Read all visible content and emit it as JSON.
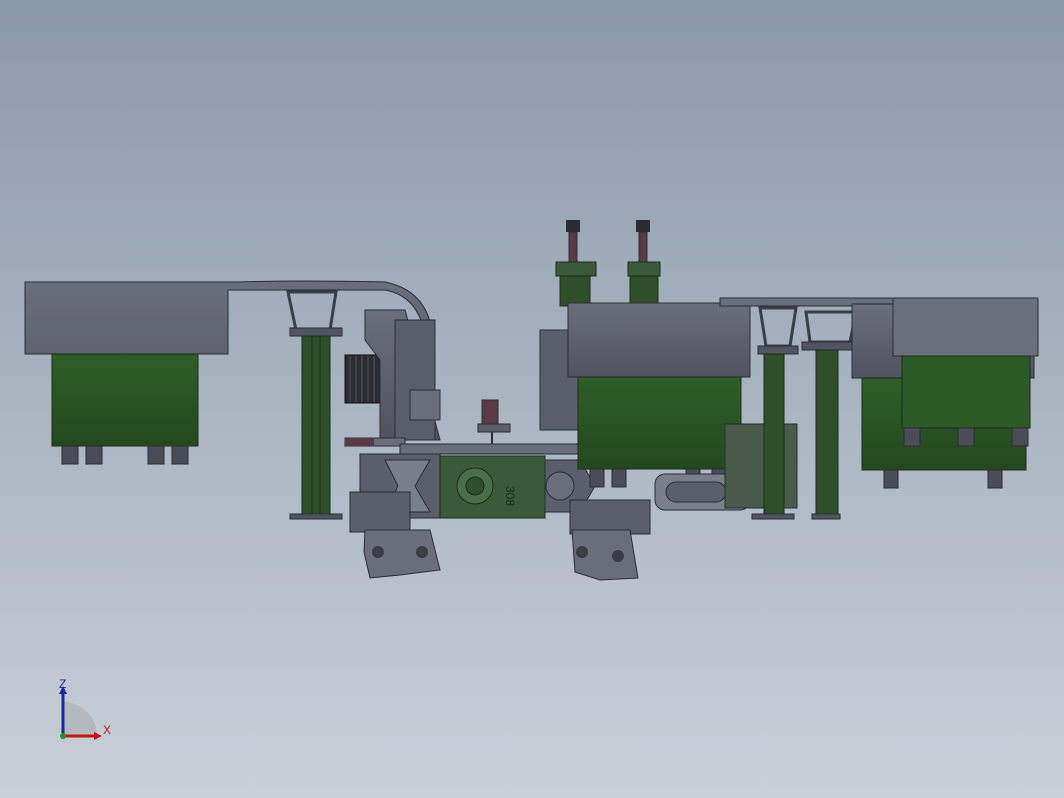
{
  "viewport": {
    "background_top": "#8a99aa",
    "background_bottom": "#c9d0d8"
  },
  "model": {
    "engraved_text": "308",
    "colors": {
      "steel": "#5b5f6b",
      "steel_dark": "#3a3d45",
      "steel_light": "#7a7f8c",
      "green": "#2f5a2a",
      "green_dark": "#223f1f",
      "maroon": "#5a3a45"
    }
  },
  "triad": {
    "z_label": "Z",
    "x_label": "X",
    "z_color": "#1a2a9a",
    "x_color": "#c01818",
    "y_color": "#1a9a1a"
  }
}
